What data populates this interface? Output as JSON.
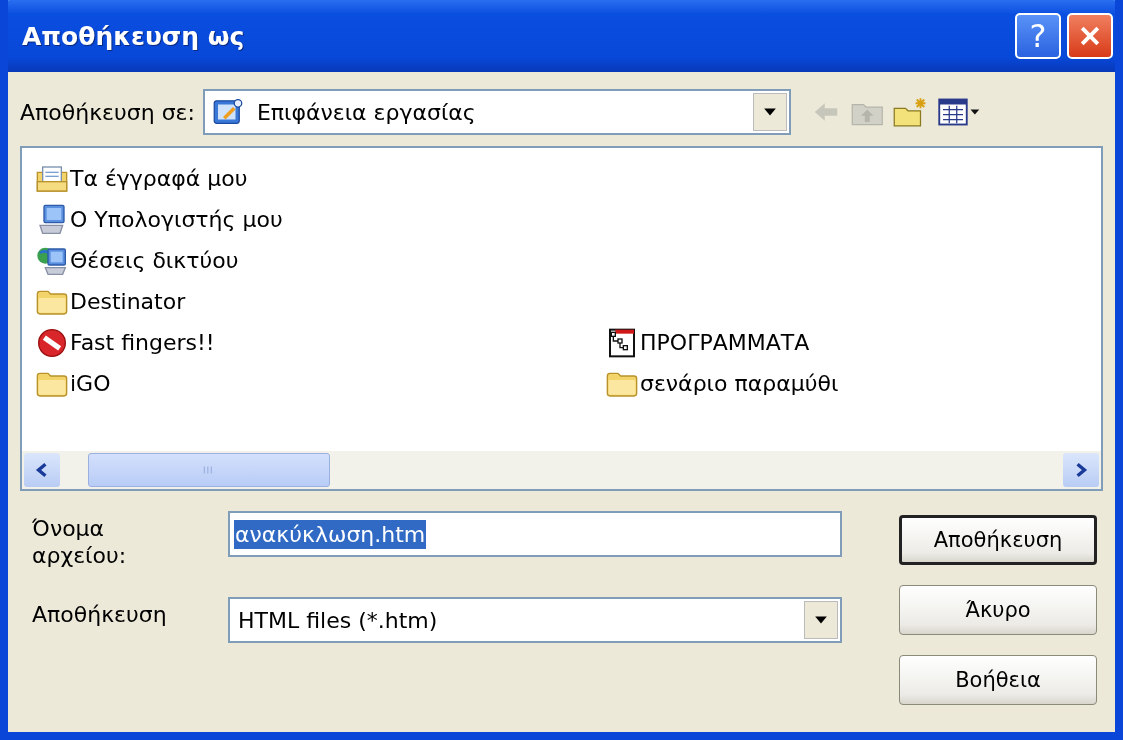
{
  "window": {
    "title": "Αποθήκευση ως",
    "help_button": "?"
  },
  "location": {
    "label": "Αποθήκευση σε:",
    "value": "Επιφάνεια εργασίας"
  },
  "toolbar": [
    {
      "kind": "back",
      "disabled": true
    },
    {
      "kind": "up",
      "disabled": true
    },
    {
      "kind": "new-folder",
      "disabled": false
    },
    {
      "kind": "view-menu",
      "disabled": false
    }
  ],
  "file_list": {
    "rows": [
      {
        "items": [
          {
            "name": "Τα έγγραφά μου",
            "kind": "documents"
          }
        ]
      },
      {
        "items": [
          {
            "name": "Ο Υπολογιστής μου",
            "kind": "computer"
          }
        ]
      },
      {
        "items": [
          {
            "name": "Θέσεις δικτύου",
            "kind": "network"
          }
        ]
      },
      {
        "items": [
          {
            "name": "Destinator",
            "kind": "folder"
          }
        ]
      },
      {
        "items": [
          {
            "name": "Fast fingers!!",
            "kind": "blocked"
          },
          {
            "name": "ΠΡΟΓΡΑΜΜΑΤΑ",
            "kind": "program"
          }
        ]
      },
      {
        "items": [
          {
            "name": "iGO",
            "kind": "folder"
          },
          {
            "name": "σενάριο παραμύθι",
            "kind": "folder"
          }
        ]
      }
    ]
  },
  "file_name": {
    "label": "Όνομα αρχείου:",
    "value": "ανακύκλωση.htm",
    "selected": true
  },
  "file_type": {
    "label": "Αποθήκευση",
    "value": "HTML files (*.htm)"
  },
  "buttons": [
    {
      "label": "Αποθήκευση",
      "default": true
    },
    {
      "label": "Άκυρο",
      "default": false
    },
    {
      "label": "Βοήθεια",
      "default": false
    }
  ]
}
